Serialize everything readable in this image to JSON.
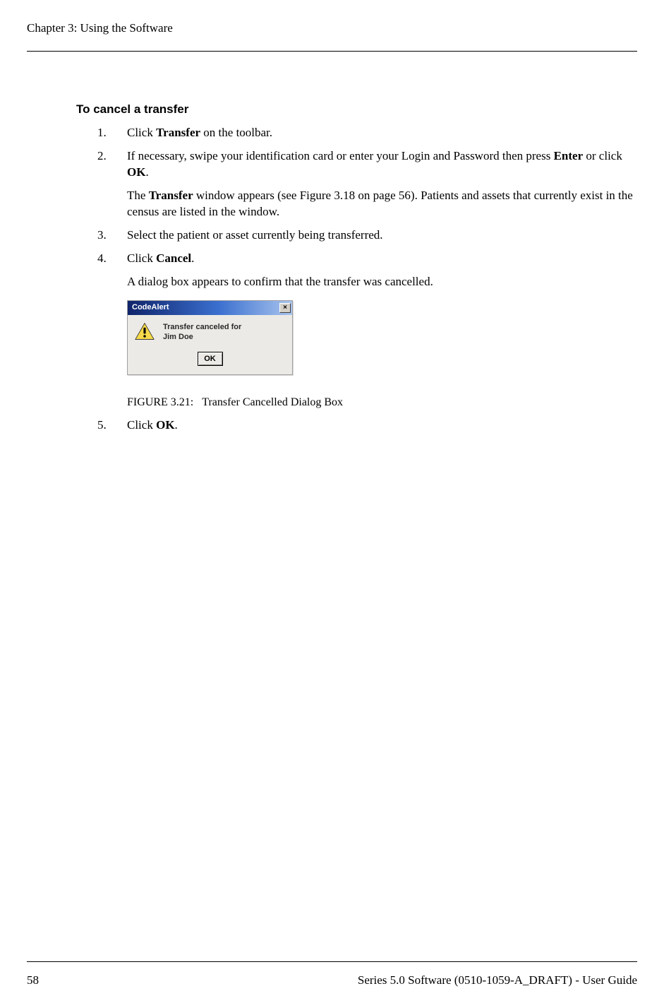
{
  "header": {
    "chapter": "Chapter 3: Using the Software"
  },
  "section": {
    "heading": "To cancel a transfer"
  },
  "steps": {
    "s1": {
      "num": "1.",
      "pre": "Click ",
      "bold": "Transfer",
      "post": " on the toolbar."
    },
    "s2": {
      "num": "2.",
      "p1_pre": "If necessary, swipe your identification card or enter your Login and Password then press ",
      "p1_b1": "Enter",
      "p1_mid": " or click ",
      "p1_b2": "OK",
      "p1_post": ".",
      "p2_pre": "The ",
      "p2_b": "Transfer",
      "p2_post": " window appears (see Figure 3.18 on page 56). Patients and assets that currently exist in the census are listed in the window."
    },
    "s3": {
      "num": "3.",
      "text": "Select the patient or asset currently being transferred."
    },
    "s4": {
      "num": "4.",
      "pre": "Click ",
      "bold": "Cancel",
      "post": ".",
      "after": "A dialog box appears to confirm that the transfer was cancelled."
    },
    "s5": {
      "num": "5.",
      "pre": "Click ",
      "bold": "OK",
      "post": "."
    }
  },
  "dialog": {
    "title": "CodeAlert",
    "close": "×",
    "line1": "Transfer canceled for",
    "line2": "Jim Doe",
    "ok": "OK"
  },
  "figure": {
    "label": "FIGURE 3.21:",
    "caption": "Transfer Cancelled Dialog Box"
  },
  "footer": {
    "page": "58",
    "doc": "Series 5.0 Software (0510-1059-A_DRAFT) - User Guide"
  }
}
